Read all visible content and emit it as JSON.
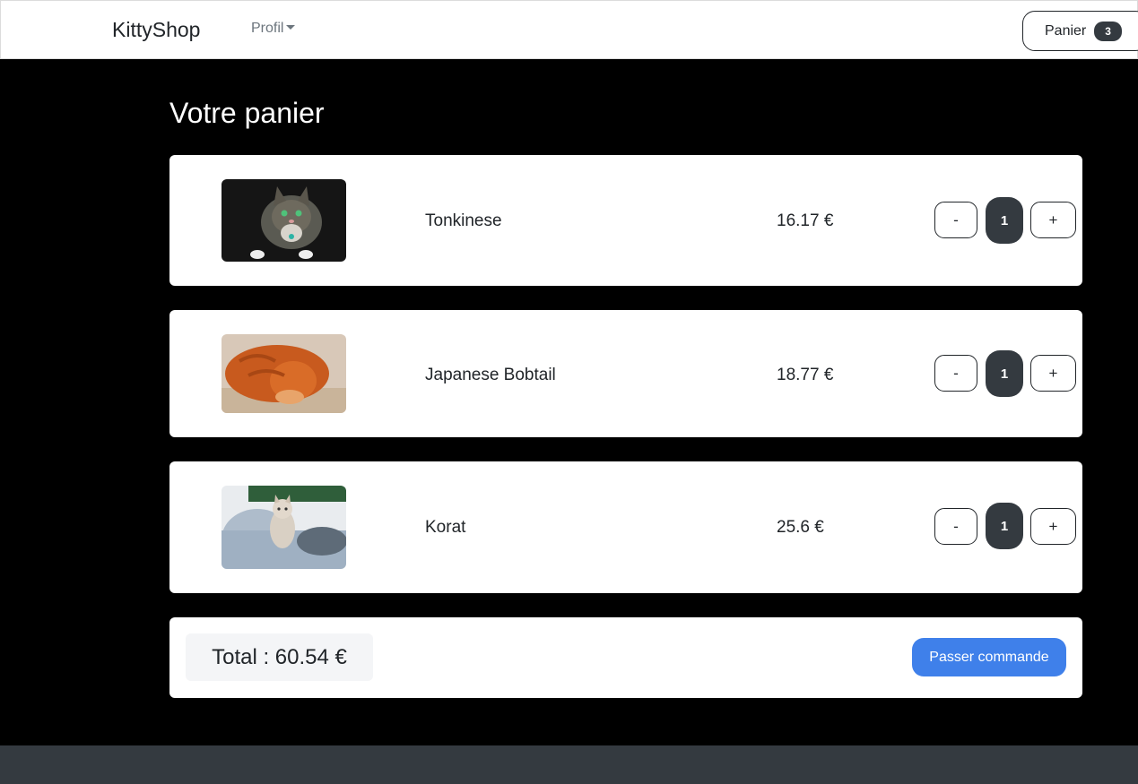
{
  "navbar": {
    "brand": "KittyShop",
    "profile_menu": "Profil",
    "cart_label": "Panier",
    "cart_count": "3"
  },
  "page": {
    "title": "Votre panier"
  },
  "cart": {
    "items": [
      {
        "name": "Tonkinese",
        "price": "16.17 €",
        "quantity": "1",
        "minus": "-",
        "plus": "+",
        "image": "tabby-cat-photo"
      },
      {
        "name": "Japanese Bobtail",
        "price": "18.77 €",
        "quantity": "1",
        "minus": "-",
        "plus": "+",
        "image": "orange-cat-photo"
      },
      {
        "name": "Korat",
        "price": "25.6 €",
        "quantity": "1",
        "minus": "-",
        "plus": "+",
        "image": "kitten-on-sofa-photo"
      }
    ],
    "total": "Total : 60.54 €",
    "checkout_label": "Passer commande"
  },
  "colors": {
    "primary": "#3f80ea",
    "dark": "#343a40",
    "background": "#000000"
  }
}
